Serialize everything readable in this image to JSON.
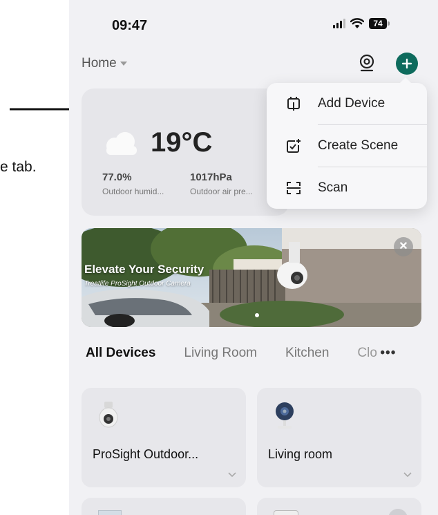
{
  "outside": {
    "cutoff_text": "e tab."
  },
  "status_bar": {
    "time": "09:47",
    "battery": "74"
  },
  "header": {
    "home_label": "Home"
  },
  "weather": {
    "temperature": "19°C",
    "humidity_value": "77.0%",
    "humidity_label": "Outdoor humid...",
    "pressure_value": "1017hPa",
    "pressure_label": "Outdoor air pre..."
  },
  "menu": {
    "items": [
      {
        "label": "Add Device",
        "icon": "add-device-icon"
      },
      {
        "label": "Create Scene",
        "icon": "create-scene-icon"
      },
      {
        "label": "Scan",
        "icon": "scan-icon"
      }
    ]
  },
  "banner": {
    "title": "Elevate Your Security",
    "subtitle": "Treatlife ProSight Outdoor Camera"
  },
  "tabs": [
    "All Devices",
    "Living Room",
    "Kitchen",
    "Clo"
  ],
  "devices": [
    {
      "name": "ProSight Outdoor...",
      "icon": "outdoor-camera-icon"
    },
    {
      "name": "Living room",
      "icon": "indoor-camera-icon"
    }
  ],
  "colors": {
    "accent": "#0e6b5d",
    "background": "#f1f1f4",
    "card": "#e7e7eb"
  }
}
